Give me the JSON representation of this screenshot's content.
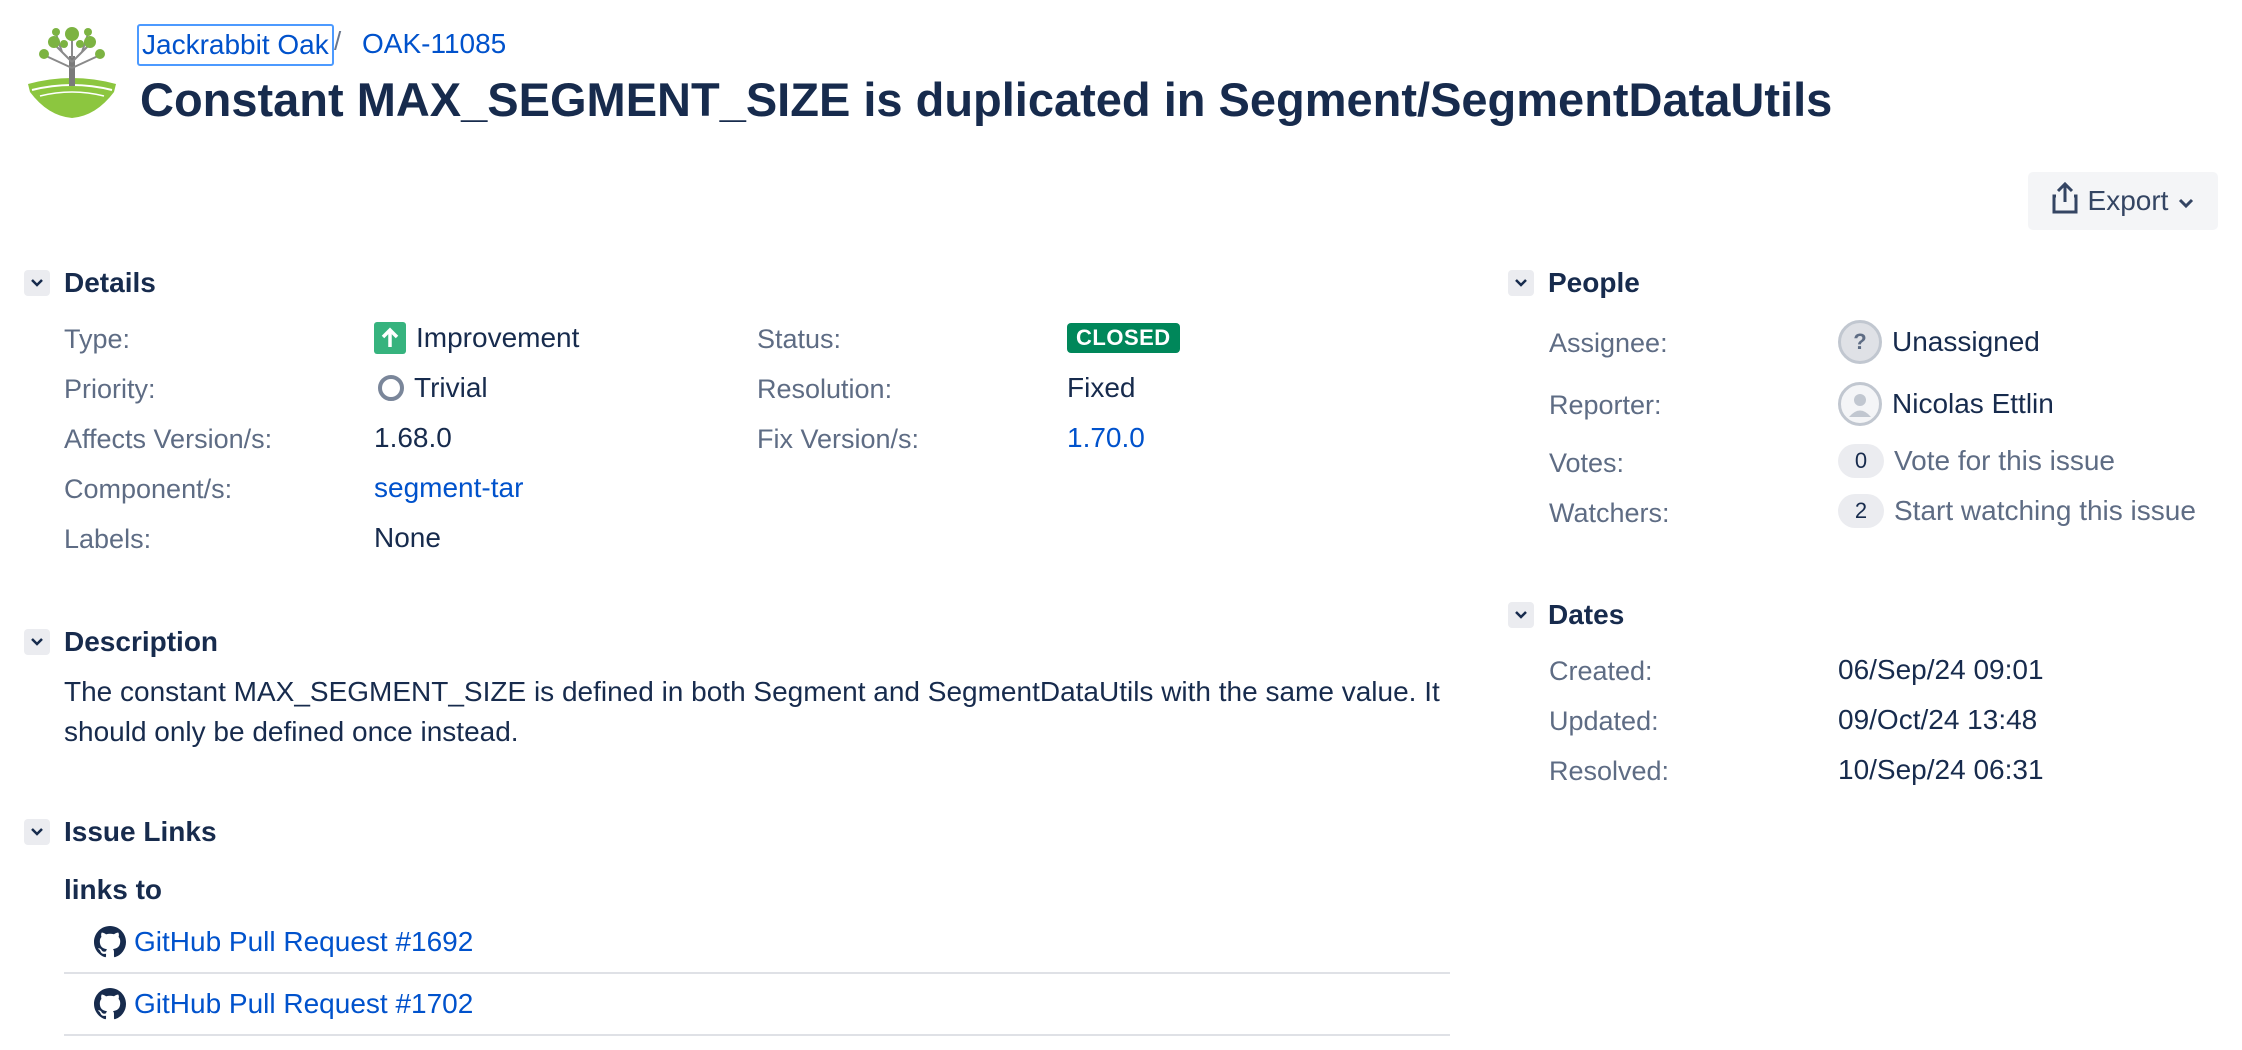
{
  "breadcrumb": {
    "project": "Jackrabbit Oak",
    "separator": "/",
    "issue_key": "OAK-11085"
  },
  "issue": {
    "title": "Constant MAX_SEGMENT_SIZE is duplicated in Segment/SegmentDataUtils"
  },
  "toolbar": {
    "export_label": "Export"
  },
  "details": {
    "heading": "Details",
    "type_label": "Type:",
    "type_value": "Improvement",
    "priority_label": "Priority:",
    "priority_value": "Trivial",
    "affects_label": "Affects Version/s:",
    "affects_value": "1.68.0",
    "component_label": "Component/s:",
    "component_value": "segment-tar",
    "labels_label": "Labels:",
    "labels_value": "None",
    "status_label": "Status:",
    "status_value": "CLOSED",
    "resolution_label": "Resolution:",
    "resolution_value": "Fixed",
    "fix_label": "Fix Version/s:",
    "fix_value": "1.70.0"
  },
  "description": {
    "heading": "Description",
    "text": "The constant MAX_SEGMENT_SIZE is defined in both Segment and SegmentDataUtils with the same value. It should only be defined once instead."
  },
  "issue_links": {
    "heading": "Issue Links",
    "relation": "links to",
    "links": [
      "GitHub Pull Request #1692",
      "GitHub Pull Request #1702"
    ]
  },
  "people": {
    "heading": "People",
    "assignee_label": "Assignee:",
    "assignee_value": "Unassigned",
    "reporter_label": "Reporter:",
    "reporter_value": "Nicolas Ettlin",
    "votes_label": "Votes:",
    "votes_count": "0",
    "votes_action": "Vote for this issue",
    "watchers_label": "Watchers:",
    "watchers_count": "2",
    "watchers_action": "Start watching this issue"
  },
  "dates": {
    "heading": "Dates",
    "created_label": "Created:",
    "created_value": "06/Sep/24 09:01",
    "updated_label": "Updated:",
    "updated_value": "09/Oct/24 13:48",
    "resolved_label": "Resolved:",
    "resolved_value": "10/Sep/24 06:31"
  },
  "colors": {
    "link": "#0052cc",
    "status_closed": "#00875a",
    "type_improvement": "#36b37e",
    "text": "#172b4d",
    "muted": "#5e6c84"
  },
  "icons": [
    "project-tree-logo",
    "export-share-icon",
    "chevron-down-icon",
    "improvement-arrow-icon",
    "trivial-priority-icon",
    "github-icon",
    "unknown-user-avatar",
    "user-avatar"
  ]
}
